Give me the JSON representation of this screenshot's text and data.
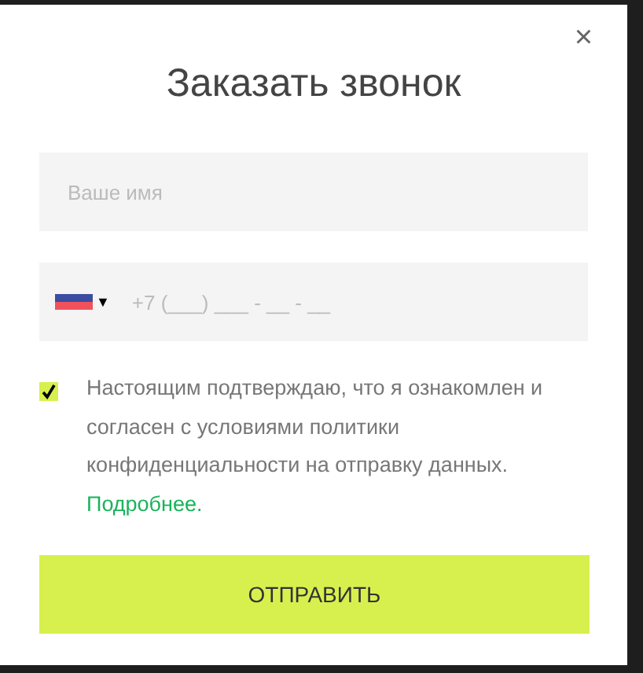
{
  "modal": {
    "title": "Заказать звонок",
    "close_label": "×"
  },
  "name_field": {
    "placeholder": "Ваше имя"
  },
  "phone_field": {
    "country_caret": "▼",
    "placeholder": "+7 (___) ___ - __ - __"
  },
  "consent": {
    "checked": true,
    "text": "Настоящим подтверждаю, что я ознакомлен и согласен с условиями политики конфиденциальности на отправку данных.",
    "link": "Подробнее."
  },
  "submit_button": {
    "label": "ОТПРАВИТЬ"
  }
}
